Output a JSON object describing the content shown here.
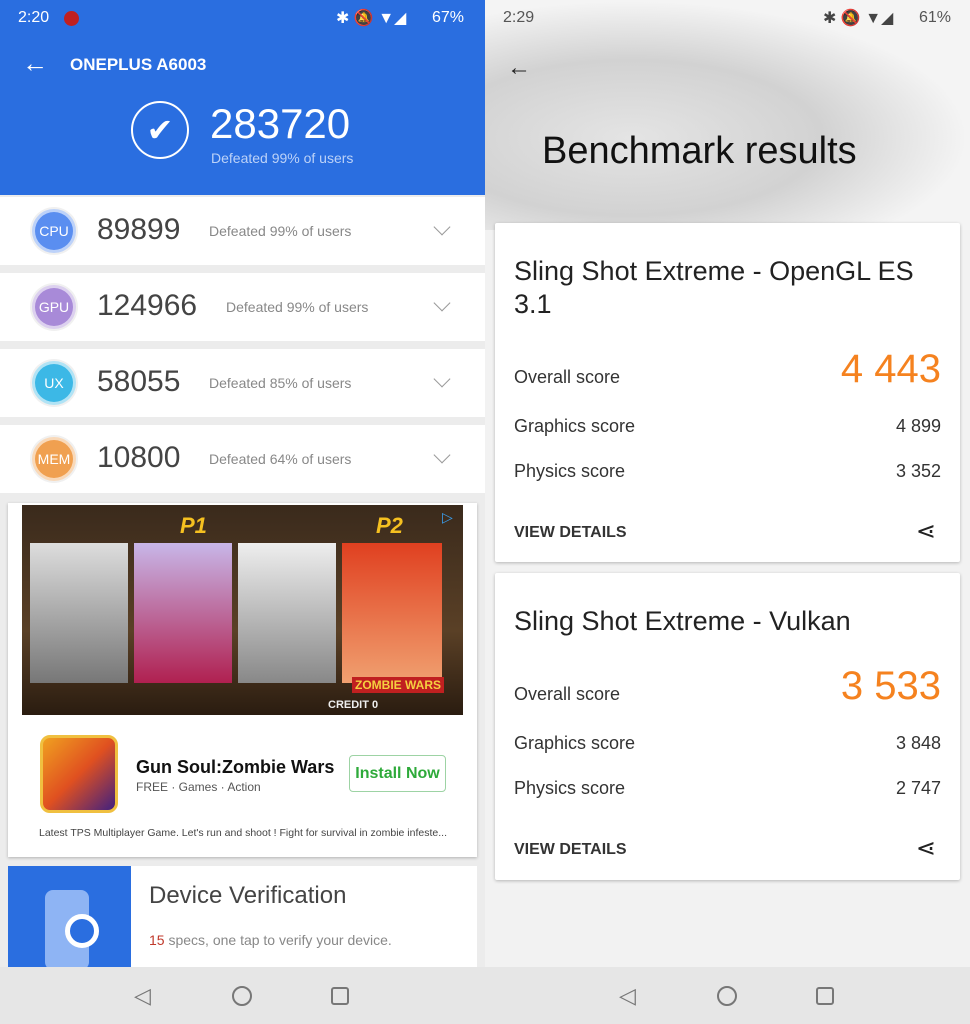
{
  "left": {
    "status_bar": {
      "time": "2:20",
      "battery": "67%"
    },
    "header": {
      "title": "ONEPLUS A6003",
      "total_score": "283720",
      "total_defeated": "Defeated 99% of users"
    },
    "categories": [
      {
        "badge": "CPU",
        "score": "89899",
        "defeated": "Defeated 99% of users",
        "color": "#5a8ef0"
      },
      {
        "badge": "GPU",
        "score": "124966",
        "defeated": "Defeated 99% of users",
        "color": "#a88ad8"
      },
      {
        "badge": "UX",
        "score": "58055",
        "defeated": "Defeated 85% of users",
        "color": "#3cb8e6"
      },
      {
        "badge": "MEM",
        "score": "10800",
        "defeated": "Defeated 64% of users",
        "color": "#f0a050"
      }
    ],
    "ad": {
      "banner": {
        "p1": "P1",
        "p2": "P2",
        "logo": "ZOMBIE WARS",
        "credit": "CREDIT 0"
      },
      "app_name": "Gun Soul:Zombie Wars",
      "app_meta": "FREE · Games · Action",
      "install_label": "Install Now",
      "description": "Latest TPS Multiplayer Game. Let's run and shoot ! Fight for survival in zombie infeste..."
    },
    "device_verification": {
      "title": "Device Verification",
      "count": "15",
      "text": " specs, one tap to verify your device."
    }
  },
  "right": {
    "status_bar": {
      "time": "2:29",
      "battery": "61%"
    },
    "title": "Benchmark results",
    "results": [
      {
        "name": "Sling Shot Extreme - OpenGL ES 3.1",
        "overall_label": "Overall score",
        "overall": "4 443",
        "graphics_label": "Graphics score",
        "graphics": "4 899",
        "physics_label": "Physics score",
        "physics": "3 352",
        "details_label": "VIEW DETAILS"
      },
      {
        "name": "Sling Shot Extreme - Vulkan",
        "overall_label": "Overall score",
        "overall": "3 533",
        "graphics_label": "Graphics score",
        "graphics": "3 848",
        "physics_label": "Physics score",
        "physics": "2 747",
        "details_label": "VIEW DETAILS"
      }
    ]
  },
  "colors": {
    "header_blue": "#2a6ee0",
    "score_orange": "#f5821f",
    "install_green": "#2eaa3a"
  }
}
